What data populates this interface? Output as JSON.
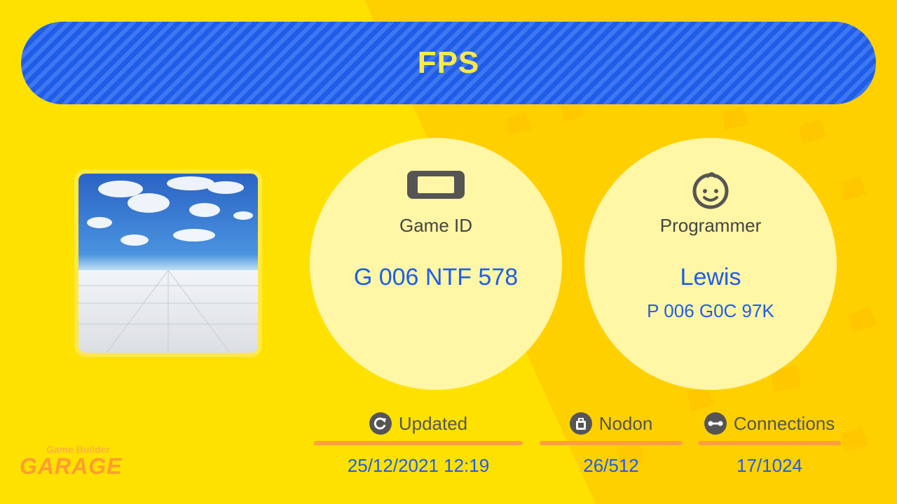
{
  "title": "FPS",
  "thumbnail": {
    "description_icon": "sky-floor-thumbnail"
  },
  "game_id": {
    "icon": "switch-console-icon",
    "label": "Game ID",
    "value": "G 006 NTF 578"
  },
  "programmer": {
    "icon": "smiley-face-icon",
    "label": "Programmer",
    "name": "Lewis",
    "id": "P 006 G0C 97K"
  },
  "stats": {
    "updated": {
      "icon": "refresh-icon",
      "label": "Updated",
      "value": "25/12/2021 12:19"
    },
    "nodon": {
      "icon": "bag-icon",
      "label": "Nodon",
      "value": "26/512"
    },
    "connections": {
      "icon": "connector-icon",
      "label": "Connections",
      "value": "17/1024"
    }
  },
  "logo": {
    "line1": "Game Builder",
    "line2": "GARAGE"
  },
  "colors": {
    "background": "#ffe100",
    "accent_blue": "#1f5de8",
    "title_text": "#ffe94a",
    "underline": "#ff9d45",
    "circle": "#fff6a6"
  }
}
